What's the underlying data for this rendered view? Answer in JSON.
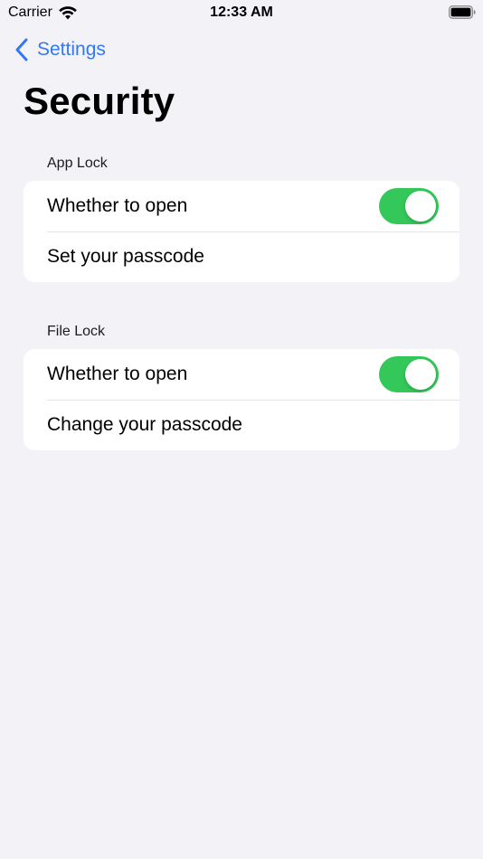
{
  "status_bar": {
    "carrier": "Carrier",
    "time": "12:33 AM",
    "wifi_icon": "wifi-icon",
    "battery_icon": "battery-full-icon"
  },
  "nav": {
    "back_label": "Settings",
    "back_icon": "chevron-left-icon",
    "accent_color": "#3478f6"
  },
  "page": {
    "title": "Security"
  },
  "sections": [
    {
      "header": "App Lock",
      "rows": [
        {
          "label": "Whether to open",
          "toggle_on": true
        },
        {
          "label": "Set your passcode"
        }
      ]
    },
    {
      "header": "File Lock",
      "rows": [
        {
          "label": "Whether to open",
          "toggle_on": true
        },
        {
          "label": "Change your passcode"
        }
      ]
    }
  ],
  "colors": {
    "background": "#f2f2f7",
    "toggle_on": "#34c759",
    "card": "#ffffff"
  }
}
